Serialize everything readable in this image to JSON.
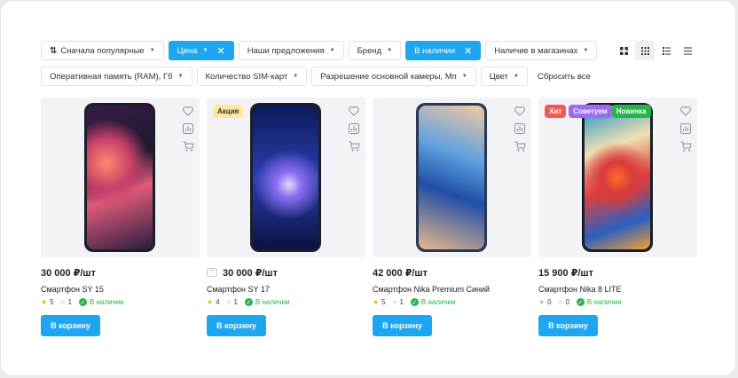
{
  "filters_row1": [
    {
      "label": "Сначала популярные",
      "type": "sort"
    },
    {
      "label": "Цена",
      "type": "active"
    },
    {
      "label": "Наши предложения",
      "type": "dropdown"
    },
    {
      "label": "Бренд",
      "type": "dropdown"
    },
    {
      "label": "В наличии",
      "type": "active"
    },
    {
      "label": "Наличие в магазинах",
      "type": "dropdown"
    }
  ],
  "filters_row2": [
    {
      "label": "Оперативная память (RAM), Гб"
    },
    {
      "label": "Количество SIM-карт"
    },
    {
      "label": "Разрешение основной камеры, Мп"
    },
    {
      "label": "Цвет"
    }
  ],
  "reset_label": "Сбросить все",
  "accent": "#1ea6f0",
  "products": [
    {
      "price": "30 000 ₽/шт",
      "name": "Смартфон SY 15",
      "rating": "5",
      "comments": "1",
      "availability": "В наличии",
      "button": "В корзину",
      "badges": []
    },
    {
      "price": "30 000 ₽/шт",
      "name": "Смартфон SY 17",
      "rating": "4",
      "comments": "1",
      "availability": "В наличии",
      "button": "В корзину",
      "badges": [
        {
          "label": "Акция",
          "color": "#fde7a0",
          "text": "#333"
        }
      ]
    },
    {
      "price": "42 000 ₽/шт",
      "name": "Смартфон Nika Premium Синий",
      "rating": "5",
      "comments": "1",
      "availability": "В наличии",
      "button": "В корзину",
      "badges": []
    },
    {
      "price": "15 900 ₽/шт",
      "name": "Смартфон Nika 8 LITE",
      "rating": "0",
      "comments": "0",
      "availability": "В наличии",
      "button": "В корзину",
      "badges": [
        {
          "label": "Хит",
          "color": "#f05a4f",
          "text": "#fff"
        },
        {
          "label": "Советуем",
          "color": "#9b6cf0",
          "text": "#fff"
        },
        {
          "label": "Новинка",
          "color": "#27b44a",
          "text": "#fff"
        }
      ]
    }
  ]
}
